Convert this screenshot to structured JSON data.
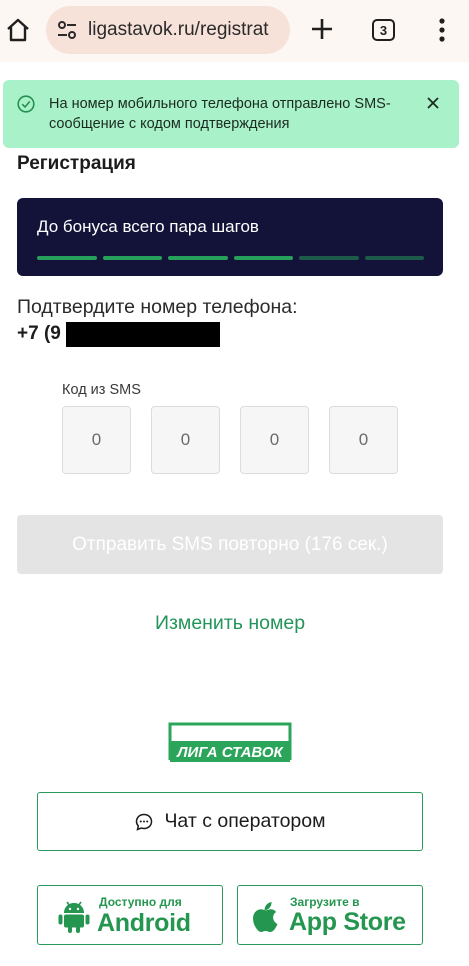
{
  "browser": {
    "url": "ligastavok.ru/registrat",
    "tab_count": "3"
  },
  "notification": {
    "text": "На номер мобильного телефона отправлено SMS-сообщение с кодом подтверждения"
  },
  "page": {
    "title": "Регистрация",
    "bonus_text": "До бонуса всего пара шагов",
    "bonus_steps_completed": 4,
    "bonus_steps_total": 6,
    "confirm_label": "Подтвердите номер телефона:",
    "phone_prefix": "+7 (9"
  },
  "sms": {
    "label": "Код из SMS",
    "digits": [
      "0",
      "0",
      "0",
      "0"
    ]
  },
  "buttons": {
    "resend": "Отправить SMS повторно (176 сек.)",
    "change_number": "Изменить номер",
    "chat": "Чат с оператором"
  },
  "logo": {
    "text": "ЛИГА СТАВОК"
  },
  "stores": {
    "android_small": "Доступно для",
    "android_big": "Android",
    "apple_small": "Загрузите в",
    "apple_big": "App Store"
  },
  "colors": {
    "accent_green": "#23945a",
    "notification_bg": "#a9f2c9",
    "bonus_card_bg": "#13133a"
  }
}
